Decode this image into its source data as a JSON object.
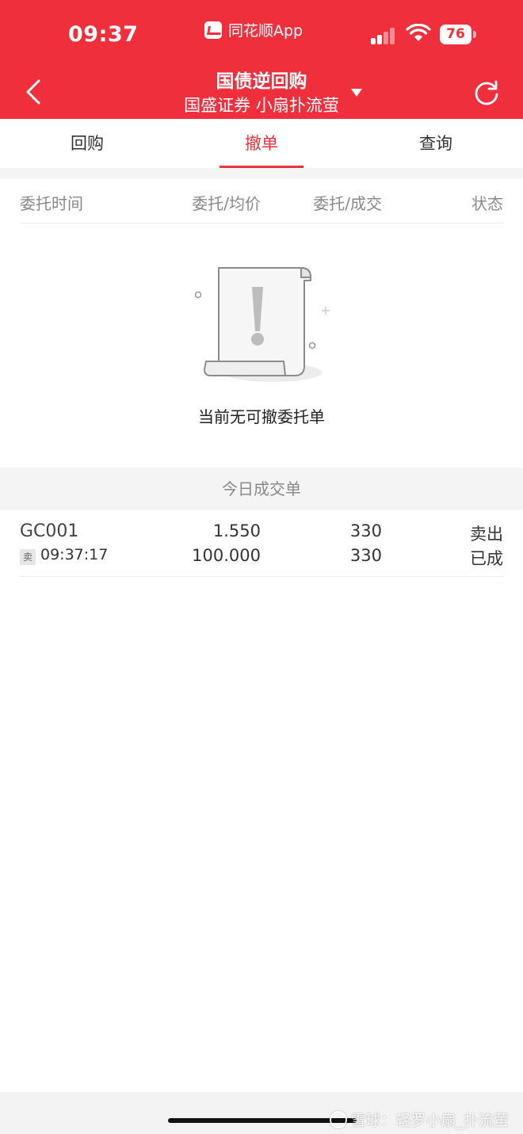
{
  "status_bar": {
    "time": "09:37",
    "carrier_app": "同花顺App",
    "battery": "76",
    "signal_icon": "signal-bars-icon",
    "wifi_icon": "wifi-icon"
  },
  "header": {
    "title": "国债逆回购",
    "subtitle": "国盛证券 小扇扑流萤",
    "back_icon": "chevron-left-icon",
    "caret_icon": "caret-down-icon",
    "refresh_icon": "refresh-icon",
    "background_color": "#ef2f3c"
  },
  "tabs": [
    {
      "label": "回购",
      "active": false
    },
    {
      "label": "撤单",
      "active": true
    },
    {
      "label": "查询",
      "active": false
    }
  ],
  "columns": {
    "time": "委托时间",
    "price": "委托/均价",
    "quantity": "委托/成交",
    "status": "状态"
  },
  "empty_state": {
    "icon": "document-exclamation-icon",
    "message": "当前无可撤委托单"
  },
  "today": {
    "section_title": "今日成交单",
    "rows": [
      {
        "code": "GC001",
        "side_tag": "卖",
        "time": "09:37:17",
        "price": "1.550",
        "avg_price": "100.000",
        "order_qty": "330",
        "filled_qty": "330",
        "direction": "卖出",
        "status": "已成"
      }
    ]
  },
  "watermark": "雪球：轻罗小扇_扑流萤",
  "accent_color": "#e8333f"
}
